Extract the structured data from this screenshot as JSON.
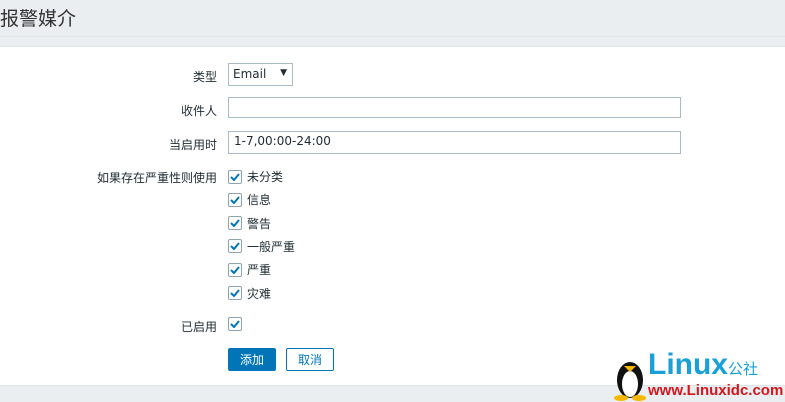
{
  "header": {
    "title": "报警媒介"
  },
  "form": {
    "type_label": "类型",
    "type_value": "Email",
    "recipient_label": "收件人",
    "recipient_value": "",
    "active_label": "当启用时",
    "active_value": "1-7,00:00-24:00",
    "severity_label": "如果存在严重性则使用",
    "severities": [
      {
        "label": "未分类",
        "checked": true
      },
      {
        "label": "信息",
        "checked": true
      },
      {
        "label": "警告",
        "checked": true
      },
      {
        "label": "一般严重",
        "checked": true
      },
      {
        "label": "严重",
        "checked": true
      },
      {
        "label": "灾难",
        "checked": true
      }
    ],
    "enabled_label": "已启用",
    "enabled": true
  },
  "buttons": {
    "add": "添加",
    "cancel": "取消"
  },
  "watermark": {
    "brand": "Linux",
    "suffix": "公社",
    "url": "www.Linuxidc.com"
  },
  "colors": {
    "accent": "#0275b8",
    "check": "#0275b8"
  }
}
